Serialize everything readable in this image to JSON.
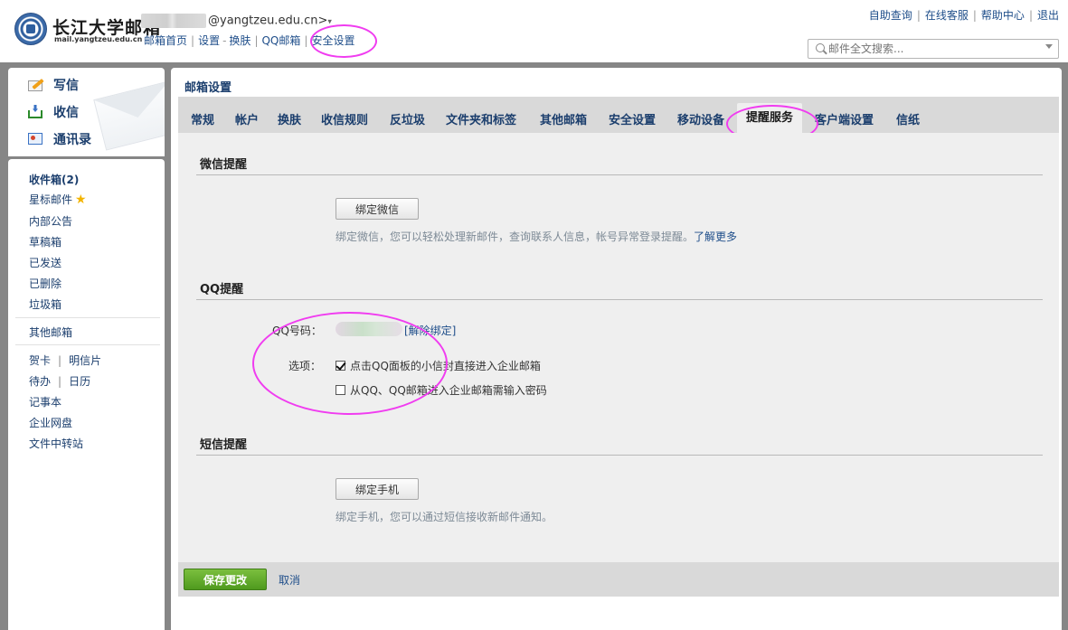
{
  "logo": {
    "name": "长江大学邮箱",
    "domain": "mail.yangtzeu.edu.cn"
  },
  "user": {
    "email_suffix": "@yangtzeu.edu.cn>",
    "dropdown": "▾"
  },
  "topnav": {
    "home": "邮箱首页",
    "settings": "设置",
    "dash": "-",
    "skin": "换肤",
    "qqmail": "QQ邮箱",
    "security": "安全设置"
  },
  "toplinks": {
    "self_query": "自助查询",
    "online_service": "在线客服",
    "help": "帮助中心",
    "logout": "退出"
  },
  "search": {
    "placeholder": "邮件全文搜索..."
  },
  "sidebar": {
    "compose": "写信",
    "receive": "收信",
    "contacts": "通讯录",
    "inbox": "收件箱(2)",
    "starred": "星标邮件",
    "announcement": "内部公告",
    "drafts": "草稿箱",
    "sent": "已发送",
    "deleted": "已删除",
    "spam": "垃圾箱",
    "other_mailbox": "其他邮箱",
    "greeting_card": "贺卡",
    "postcard": "明信片",
    "todo": "待办",
    "calendar": "日历",
    "notes": "记事本",
    "netdisk": "企业网盘",
    "transfer": "文件中转站"
  },
  "main": {
    "title": "邮箱设置",
    "tabs": [
      "常规",
      "帐户",
      "换肤",
      "收信规则",
      "反垃圾",
      "文件夹和标签",
      "其他邮箱",
      "安全设置",
      "移动设备",
      "提醒服务",
      "客户端设置",
      "信纸"
    ],
    "active_tab": "提醒服务"
  },
  "wechat": {
    "title": "微信提醒",
    "button": "绑定微信",
    "hint": "绑定微信，您可以轻松处理新邮件，查询联系人信息，帐号异常登录提醒。",
    "more": "了解更多"
  },
  "qq": {
    "title": "QQ提醒",
    "qq_label": "QQ号码：",
    "unbind": "[解除绑定]",
    "options_label": "选项：",
    "option1": "点击QQ面板的小信封直接进入企业邮箱",
    "option1_checked": true,
    "option2": "从QQ、QQ邮箱进入企业邮箱需输入密码",
    "option2_checked": false
  },
  "sms": {
    "title": "短信提醒",
    "button": "绑定手机",
    "hint": "绑定手机，您可以通过短信接收新邮件通知。"
  },
  "footer": {
    "save": "保存更改",
    "cancel": "取消"
  },
  "colors": {
    "annotation_circle": "#f03cf0",
    "save_green": "#5fa82a",
    "link": "#1f4e8a"
  }
}
